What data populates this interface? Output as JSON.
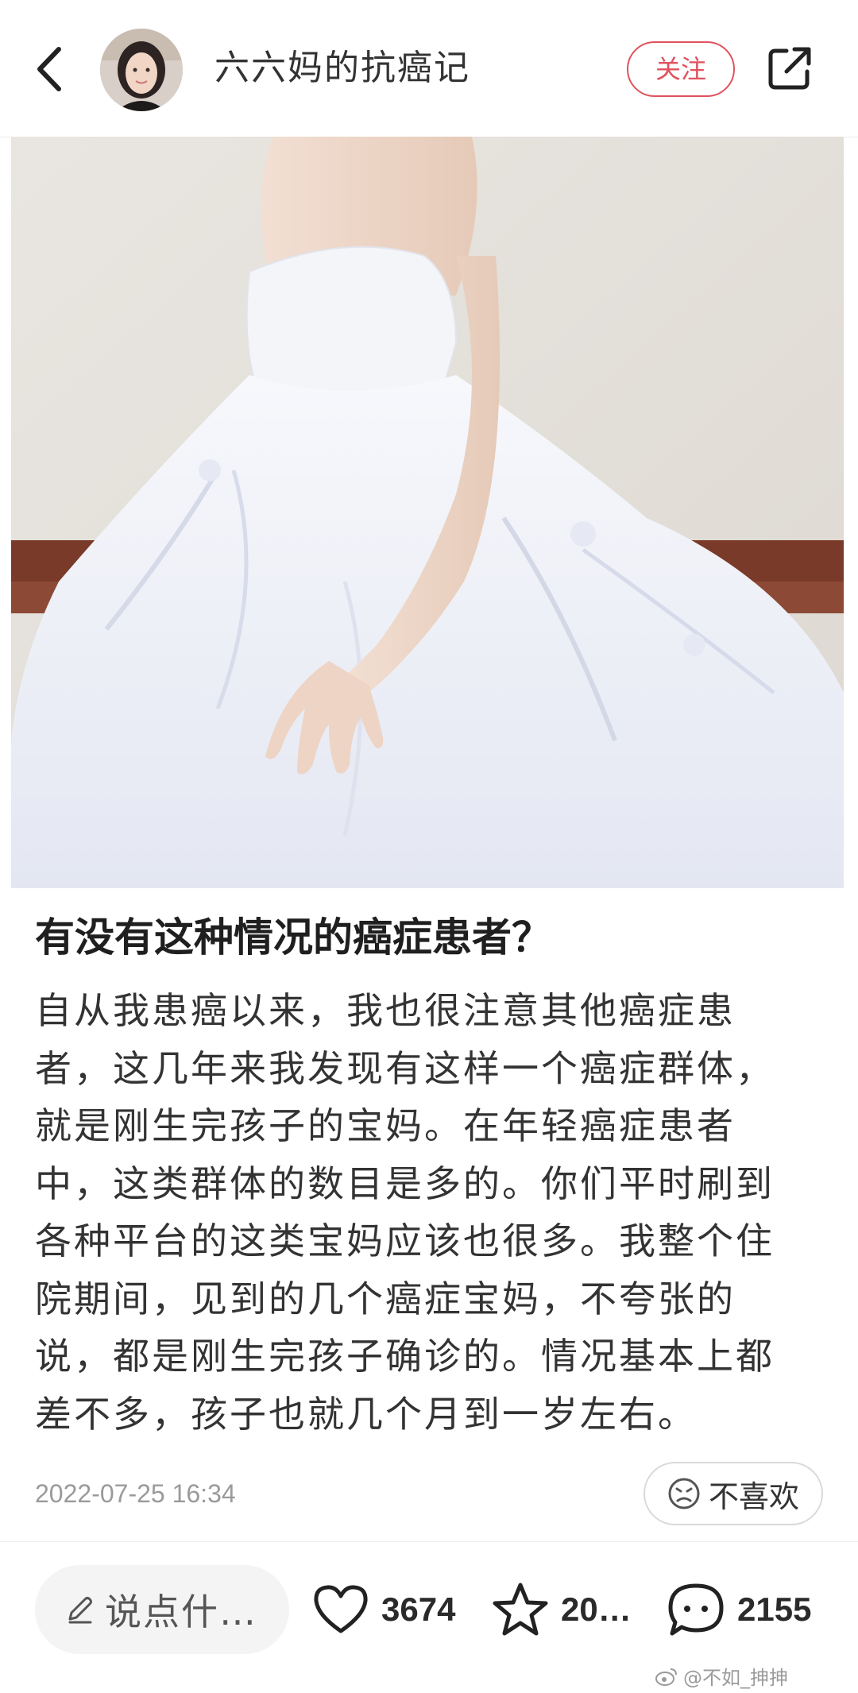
{
  "header": {
    "author_name": "六六妈的抗癌记",
    "follow_label": "关注"
  },
  "post": {
    "title": "有没有这种情况的癌症患者？",
    "body_lines": [
      "自从我患癌以来，我也很注意其他癌症患",
      "者，这几年来我发现有这样一个癌症群体，",
      "就是刚生完孩子的宝妈。在年轻癌症患者",
      "中，这类群体的数目是多的。你们平时刷到",
      "各种平台的这类宝妈应该也很多。我整个住",
      "院期间，见到的几个癌症宝妈，不夸张的",
      "说，都是刚生完孩子确诊的。情况基本上都",
      "差不多，孩子也就几个月到一岁左右。"
    ],
    "timestamp": "2022-07-25 16:34",
    "dislike_label": "不喜欢"
  },
  "bottom_bar": {
    "comment_placeholder": "说点什…",
    "like_count": "3674",
    "favorite_count": "20…",
    "comment_count": "2155"
  },
  "watermark": "@不如_抻抻",
  "icons": {
    "back": "chevron-left-icon",
    "share": "share-icon",
    "dislike": "sad-face-icon",
    "edit": "pencil-icon",
    "like": "heart-icon",
    "favorite": "star-icon",
    "comment": "chat-bubble-icon",
    "watermark": "weibo-icon"
  },
  "colors": {
    "accent": "#e0525e",
    "text_primary": "#1f1f1f",
    "text_secondary": "#9a9a9a"
  }
}
